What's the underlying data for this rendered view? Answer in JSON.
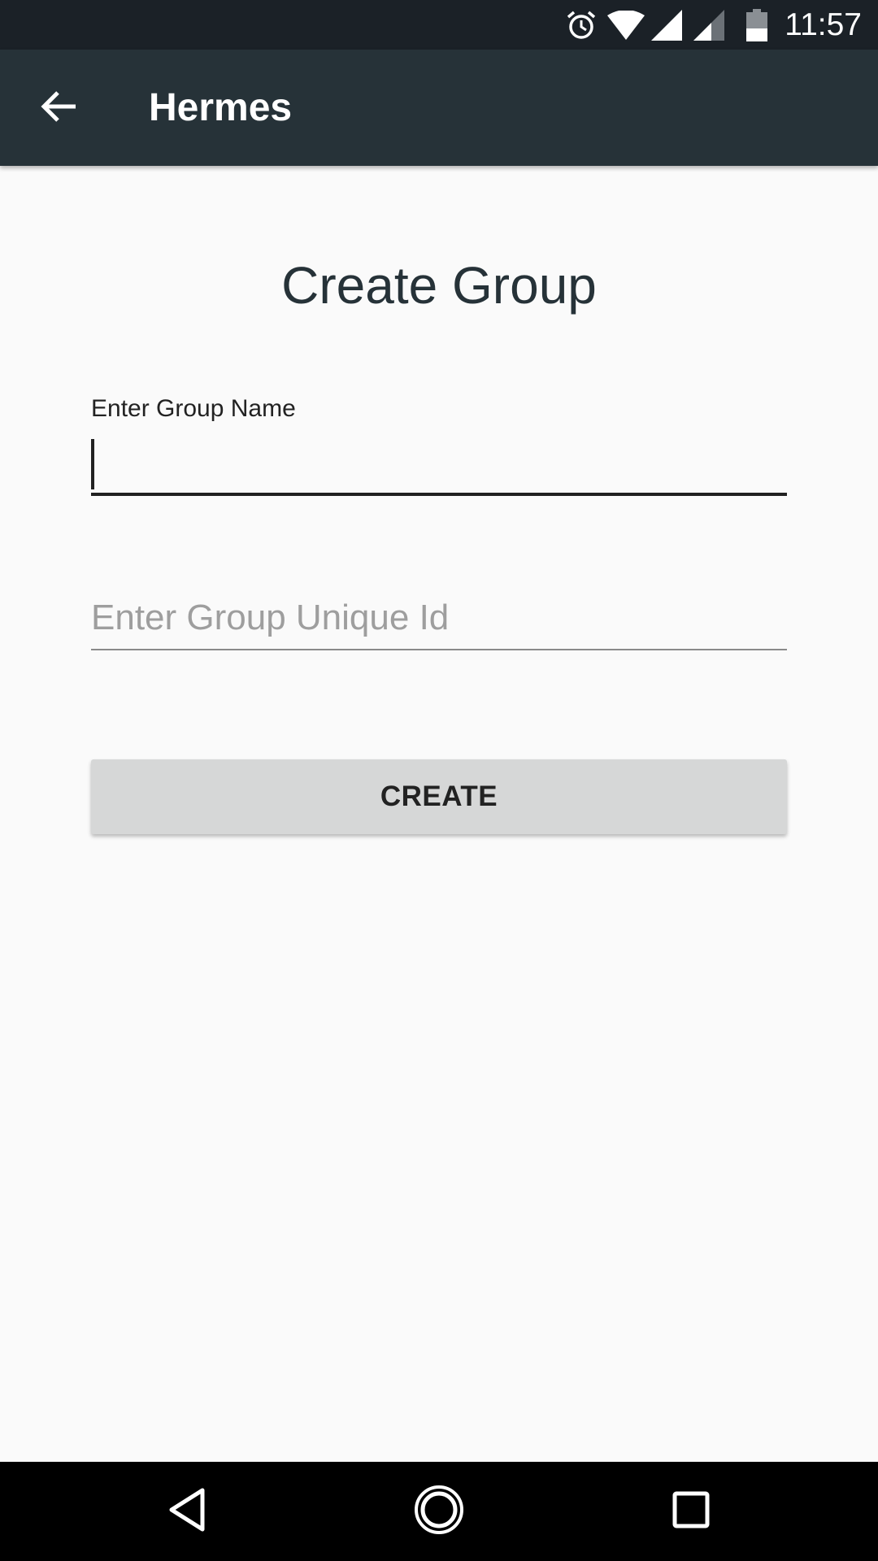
{
  "status_bar": {
    "time": "11:57",
    "icons": [
      "alarm-icon",
      "wifi-icon",
      "signal-icon",
      "signal-icon",
      "battery-icon"
    ]
  },
  "app_bar": {
    "title": "Hermes",
    "back_icon": "arrow-back-icon"
  },
  "main": {
    "title": "Create Group",
    "group_name_label": "Enter Group Name",
    "group_name_value": "",
    "group_id_placeholder": "Enter Group Unique Id",
    "group_id_value": "",
    "create_button_label": "CREATE"
  },
  "nav_bar": {
    "icons": [
      "back-triangle-icon",
      "home-circle-icon",
      "recents-square-icon"
    ]
  },
  "colors": {
    "status_bar": "#1b2127",
    "app_bar": "#263238",
    "background": "#fafafa",
    "button": "#d6d7d7",
    "title_text": "#263238"
  }
}
